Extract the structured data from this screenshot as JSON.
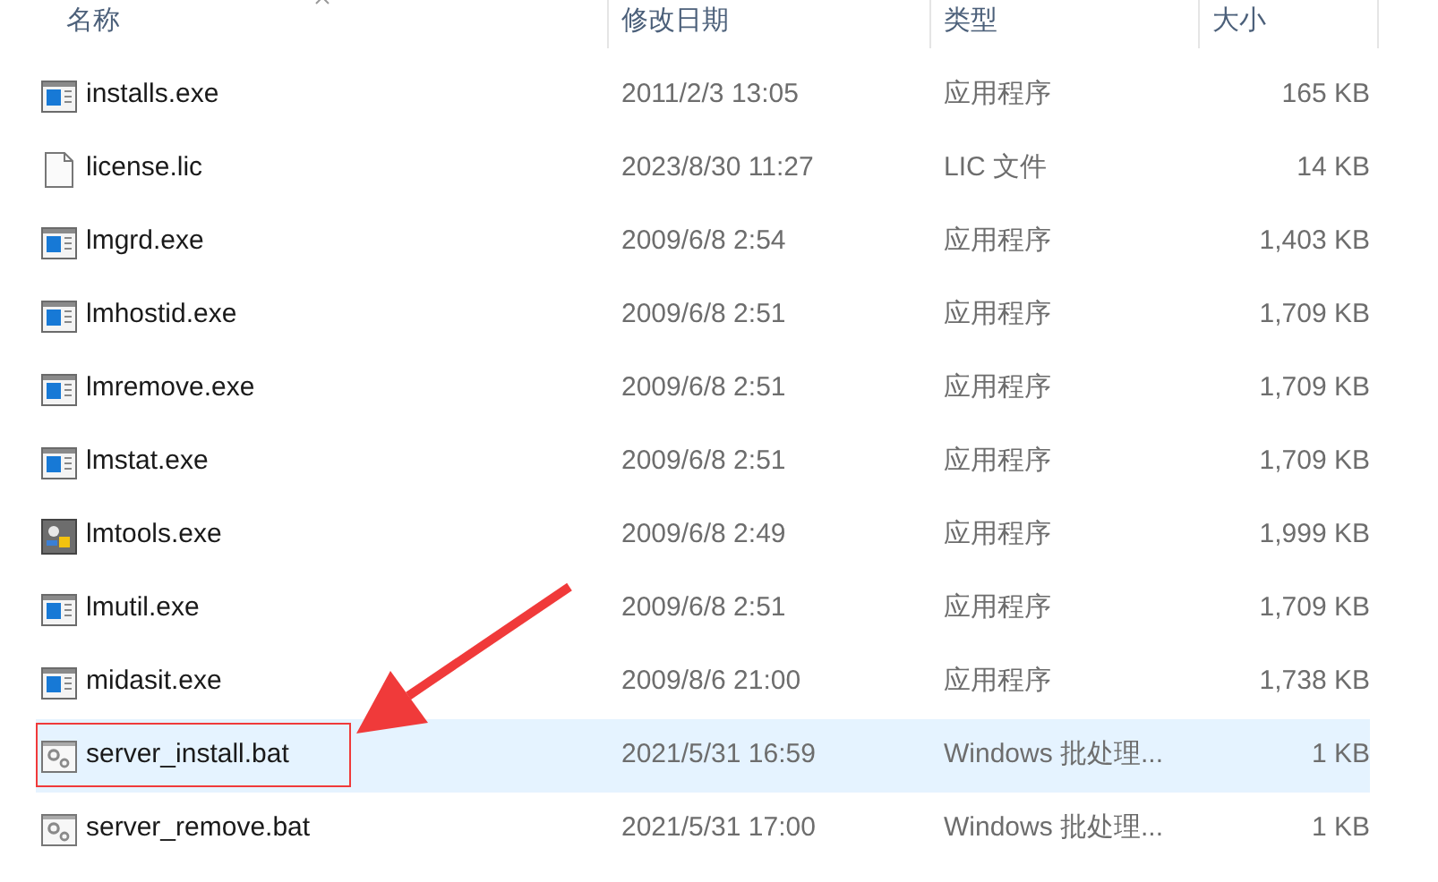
{
  "columns": [
    {
      "label": "名称",
      "sorted": true
    },
    {
      "label": "修改日期",
      "sorted": false
    },
    {
      "label": "类型",
      "sorted": false
    },
    {
      "label": "大小",
      "sorted": false
    }
  ],
  "rows": [
    {
      "kind": "exe",
      "name": "installs.exe",
      "date": "2011/2/3 13:05",
      "type": "应用程序",
      "size": "165 KB",
      "selected": false,
      "boxed": false
    },
    {
      "kind": "file",
      "name": "license.lic",
      "date": "2023/8/30 11:27",
      "type": "LIC 文件",
      "size": "14 KB",
      "selected": false,
      "boxed": false
    },
    {
      "kind": "exe",
      "name": "lmgrd.exe",
      "date": "2009/6/8 2:54",
      "type": "应用程序",
      "size": "1,403 KB",
      "selected": false,
      "boxed": false
    },
    {
      "kind": "exe",
      "name": "lmhostid.exe",
      "date": "2009/6/8 2:51",
      "type": "应用程序",
      "size": "1,709 KB",
      "selected": false,
      "boxed": false
    },
    {
      "kind": "exe",
      "name": "lmremove.exe",
      "date": "2009/6/8 2:51",
      "type": "应用程序",
      "size": "1,709 KB",
      "selected": false,
      "boxed": false
    },
    {
      "kind": "exe",
      "name": "lmstat.exe",
      "date": "2009/6/8 2:51",
      "type": "应用程序",
      "size": "1,709 KB",
      "selected": false,
      "boxed": false
    },
    {
      "kind": "tool",
      "name": "lmtools.exe",
      "date": "2009/6/8 2:49",
      "type": "应用程序",
      "size": "1,999 KB",
      "selected": false,
      "boxed": false
    },
    {
      "kind": "exe",
      "name": "lmutil.exe",
      "date": "2009/6/8 2:51",
      "type": "应用程序",
      "size": "1,709 KB",
      "selected": false,
      "boxed": false
    },
    {
      "kind": "exe",
      "name": "midasit.exe",
      "date": "2009/8/6 21:00",
      "type": "应用程序",
      "size": "1,738 KB",
      "selected": false,
      "boxed": false
    },
    {
      "kind": "batch",
      "name": "server_install.bat",
      "date": "2021/5/31 16:59",
      "type": "Windows 批处理...",
      "size": "1 KB",
      "selected": true,
      "boxed": true
    },
    {
      "kind": "batch",
      "name": "server_remove.bat",
      "date": "2021/5/31 17:00",
      "type": "Windows 批处理...",
      "size": "1 KB",
      "selected": false,
      "boxed": false
    }
  ]
}
